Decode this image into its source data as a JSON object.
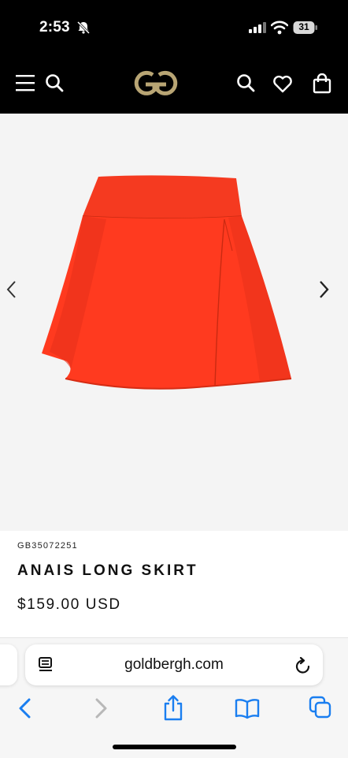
{
  "status_bar": {
    "time": "2:53",
    "battery": "31",
    "icons": [
      "bell-slash-icon",
      "signal-icon",
      "wifi-icon",
      "battery-icon"
    ]
  },
  "header": {
    "icons": [
      "menu-icon",
      "search-icon",
      "goldbergh-logo",
      "search-icon",
      "heart-icon",
      "bag-icon"
    ],
    "logo_color": "#b8a574",
    "background": "#000000"
  },
  "gallery": {
    "icons": [
      "chevron-left-icon",
      "chevron-right-icon"
    ],
    "product_color": "#ff3a1f"
  },
  "product": {
    "sku": "GB35072251",
    "name": "ANAIS LONG SKIRT",
    "price": "$159.00 USD"
  },
  "browser": {
    "url": "goldbergh.com",
    "accent": "#1a7ef0",
    "icons": [
      "reader-icon",
      "reload-icon",
      "back-icon",
      "forward-icon",
      "share-icon",
      "bookmarks-icon",
      "tabs-icon"
    ]
  }
}
